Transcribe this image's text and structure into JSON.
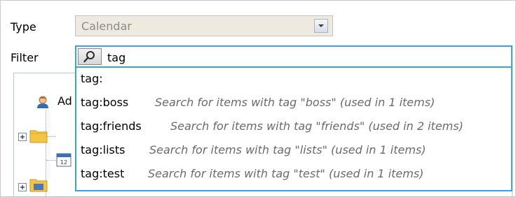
{
  "form": {
    "type_label": "Type",
    "type_value": "Calendar",
    "filter_label": "Filter",
    "filter_value": "tag"
  },
  "tree": {
    "visible_node_label": "Ad"
  },
  "suggestions": [
    {
      "tag": "tag:",
      "description": ""
    },
    {
      "tag": "tag:boss",
      "description": "Search for items with tag \"boss\" (used in 1 items)"
    },
    {
      "tag": "tag:friends",
      "description": "Search for items with tag \"friends\" (used in 2 items)"
    },
    {
      "tag": "tag:lists",
      "description": "Search for items with tag \"lists\" (used in 1 items)"
    },
    {
      "tag": "tag:test",
      "description": "Search for items with tag \"test\" (used in 1 items)"
    }
  ],
  "icons": {
    "type_dropdown": "chevron-down-icon",
    "search": "search-icon",
    "user": "user-icon",
    "folder": "folder-icon",
    "calendar": "calendar-icon",
    "expand": "expand-plus-icon"
  },
  "colors": {
    "focus_border": "#3e9ee6",
    "disabled_field_bg": "#eeeae0",
    "hint_text": "#6b6b6b"
  }
}
